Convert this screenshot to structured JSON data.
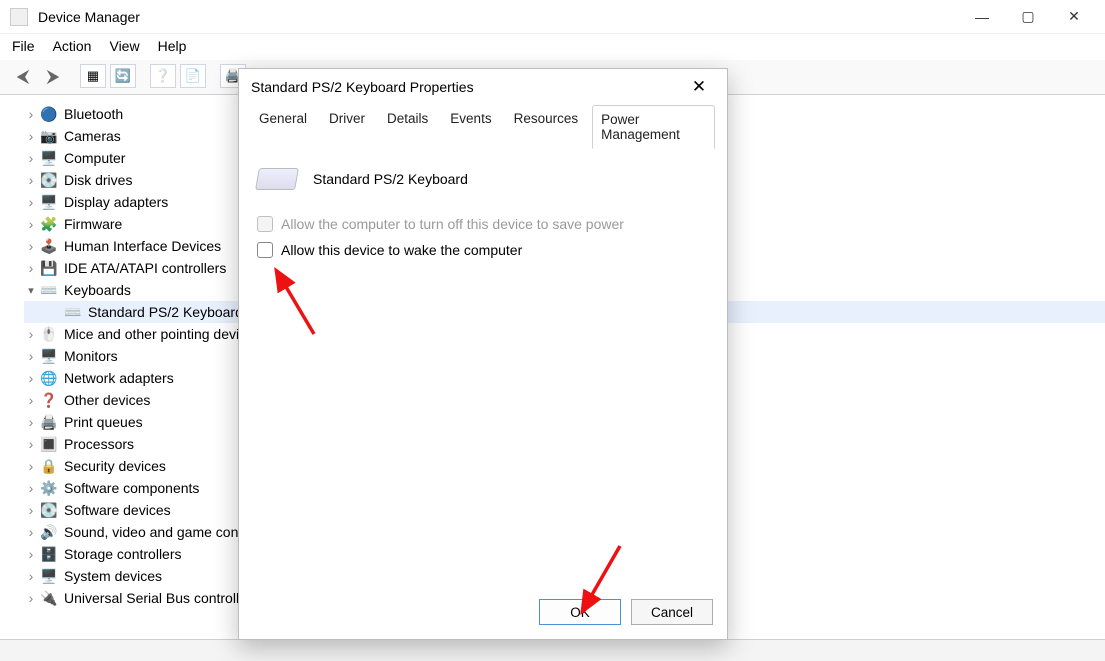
{
  "window": {
    "title": "Device Manager",
    "menus": [
      "File",
      "Action",
      "View",
      "Help"
    ]
  },
  "tree": [
    {
      "icon": "🔵",
      "label": "Bluetooth",
      "expanded": false
    },
    {
      "icon": "📷",
      "label": "Cameras",
      "expanded": false
    },
    {
      "icon": "🖥️",
      "label": "Computer",
      "expanded": false
    },
    {
      "icon": "💽",
      "label": "Disk drives",
      "expanded": false
    },
    {
      "icon": "🖥️",
      "label": "Display adapters",
      "expanded": false
    },
    {
      "icon": "🧩",
      "label": "Firmware",
      "expanded": false
    },
    {
      "icon": "🕹️",
      "label": "Human Interface Devices",
      "expanded": false
    },
    {
      "icon": "💾",
      "label": "IDE ATA/ATAPI controllers",
      "expanded": false
    },
    {
      "icon": "⌨️",
      "label": "Keyboards",
      "expanded": true,
      "children": [
        {
          "icon": "⌨️",
          "label": "Standard PS/2 Keyboard",
          "selected": true
        }
      ]
    },
    {
      "icon": "🖱️",
      "label": "Mice and other pointing devices",
      "expanded": false
    },
    {
      "icon": "🖥️",
      "label": "Monitors",
      "expanded": false
    },
    {
      "icon": "🌐",
      "label": "Network adapters",
      "expanded": false
    },
    {
      "icon": "❓",
      "label": "Other devices",
      "expanded": false
    },
    {
      "icon": "🖨️",
      "label": "Print queues",
      "expanded": false
    },
    {
      "icon": "🔳",
      "label": "Processors",
      "expanded": false
    },
    {
      "icon": "🔒",
      "label": "Security devices",
      "expanded": false
    },
    {
      "icon": "⚙️",
      "label": "Software components",
      "expanded": false
    },
    {
      "icon": "💽",
      "label": "Software devices",
      "expanded": false
    },
    {
      "icon": "🔊",
      "label": "Sound, video and game controllers",
      "expanded": false
    },
    {
      "icon": "🗄️",
      "label": "Storage controllers",
      "expanded": false
    },
    {
      "icon": "🖥️",
      "label": "System devices",
      "expanded": false
    },
    {
      "icon": "🔌",
      "label": "Universal Serial Bus controllers",
      "expanded": false
    }
  ],
  "dialog": {
    "title": "Standard PS/2 Keyboard Properties",
    "tabs": [
      "General",
      "Driver",
      "Details",
      "Events",
      "Resources",
      "Power Management"
    ],
    "activeTab": "Power Management",
    "deviceName": "Standard PS/2 Keyboard",
    "options": [
      {
        "label": "Allow the computer to turn off this device to save power",
        "enabled": false,
        "checked": false
      },
      {
        "label": "Allow this device to wake the computer",
        "enabled": true,
        "checked": false
      }
    ],
    "buttons": {
      "ok": "OK",
      "cancel": "Cancel"
    }
  }
}
